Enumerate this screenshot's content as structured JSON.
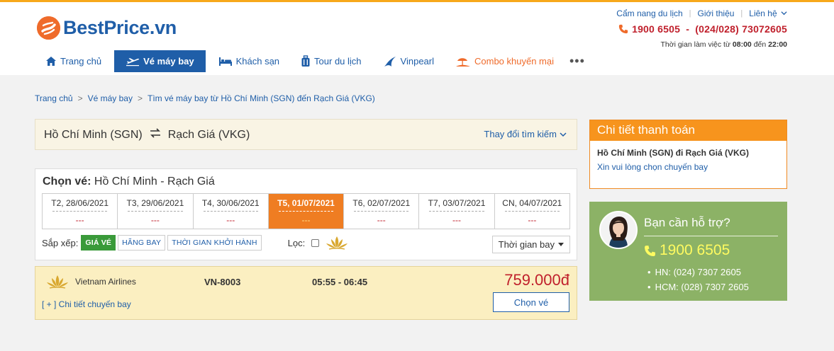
{
  "brand": {
    "name": "BestPrice.vn",
    "accent": "#f7a81b",
    "primary": "#1f5ea8",
    "orange": "#ef6b2b"
  },
  "top_links": [
    "Cẩm nang du lịch",
    "Giới thiệu",
    "Liên hệ"
  ],
  "hotline": "1900 6505  -  (024/028) 73072605",
  "worktime": {
    "prefix": "Thời gian làm việc từ",
    "start": "08:00",
    "mid": "đến",
    "end": "22:00"
  },
  "nav": [
    {
      "label": "Trang chủ",
      "icon": "home-icon"
    },
    {
      "label": "Vé máy bay",
      "icon": "plane-icon",
      "active": true
    },
    {
      "label": "Khách sạn",
      "icon": "bed-icon"
    },
    {
      "label": "Tour du lịch",
      "icon": "luggage-icon"
    },
    {
      "label": "Vinpearl",
      "icon": "vinpearl-icon"
    },
    {
      "label": "Combo khuyến mại",
      "icon": "beach-icon"
    }
  ],
  "nav_more": "•••",
  "breadcrumb": [
    "Trang chủ",
    "Vé máy bay",
    "Tìm vé máy bay từ Hồ Chí Minh (SGN) đến Rạch Giá (VKG)"
  ],
  "route": {
    "from": "Hồ Chí Minh (SGN)",
    "to": "Rạch Giá (VKG)",
    "change": "Thay đổi tìm kiếm"
  },
  "ticket": {
    "title_bold": "Chọn vé:",
    "title_rest": " Hồ Chí Minh - Rạch Giá",
    "dates": [
      {
        "label": "T2, 28/06/2021",
        "price": "---"
      },
      {
        "label": "T3, 29/06/2021",
        "price": "---"
      },
      {
        "label": "T4, 30/06/2021",
        "price": "---"
      },
      {
        "label": "T5, 01/07/2021",
        "price": "---",
        "active": true
      },
      {
        "label": "T6, 02/07/2021",
        "price": "---"
      },
      {
        "label": "T7, 03/07/2021",
        "price": "---"
      },
      {
        "label": "CN, 04/07/2021",
        "price": "---"
      }
    ],
    "sort_label": "Sắp xếp:",
    "sort_options": [
      "GIÁ VÉ",
      "HÃNG BAY",
      "THỜI GIAN KHỞI HÀNH"
    ],
    "filter_label": "Lọc:",
    "sort_select": "Thời gian bay"
  },
  "flight": {
    "airline": "Vietnam Airlines",
    "code": "VN-8003",
    "time": "05:55 - 06:45",
    "price": "759.000đ",
    "detail": "[ + ] Chi tiết chuyến bay",
    "choose": "Chọn vé"
  },
  "payment": {
    "title": "Chi tiết thanh toán",
    "route": "Hồ Chí Minh (SGN) đi Rạch Giá (VKG)",
    "hint": "Xin vui lòng chọn chuyến bay"
  },
  "support": {
    "title": "Bạn cần hỗ trợ?",
    "phone": "1900 6505",
    "lines": [
      "HN: (024) 7307 2605",
      "HCM: (028) 7307 2605"
    ]
  }
}
